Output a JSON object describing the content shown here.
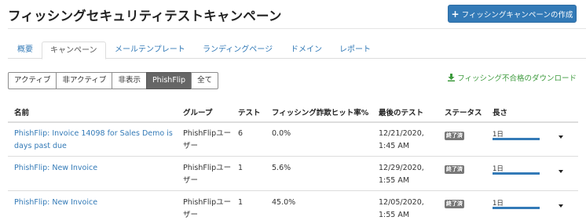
{
  "header": {
    "title": "フィッシングセキュリティテストキャンペーン",
    "create_button": "フィッシングキャンペーンの作成"
  },
  "tabs": [
    {
      "label": "概要",
      "active": false
    },
    {
      "label": "キャンペーン",
      "active": true
    },
    {
      "label": "メールテンプレート",
      "active": false
    },
    {
      "label": "ランディングページ",
      "active": false
    },
    {
      "label": "ドメイン",
      "active": false
    },
    {
      "label": "レポート",
      "active": false
    }
  ],
  "filters": [
    {
      "label": "アクティブ",
      "active": false
    },
    {
      "label": "非アクティブ",
      "active": false
    },
    {
      "label": "非表示",
      "active": false
    },
    {
      "label": "PhishFlip",
      "active": true
    },
    {
      "label": "全て",
      "active": false
    }
  ],
  "download_link": "フィッシング不合格のダウンロード",
  "table": {
    "columns": [
      "名前",
      "グループ",
      "テスト",
      "フィッシング詐欺ヒット率%",
      "最後のテスト",
      "ステータス",
      "長さ"
    ],
    "rows": [
      {
        "name": "PhishFlip: Invoice 14098 for Sales Demo is days past due",
        "group": "PhishFlipユーザー",
        "tests": "6",
        "rate": "0.0%",
        "last_test": "12/21/2020, 1:45 AM",
        "status": "終了済",
        "duration": "1日",
        "duration_fill": 1.0
      },
      {
        "name": "PhishFlip: New Invoice",
        "group": "PhishFlipユーザー",
        "tests": "1",
        "rate": "5.6%",
        "last_test": "12/29/2020, 1:55 AM",
        "status": "終了済",
        "duration": "1日",
        "duration_fill": 1.0
      },
      {
        "name": "PhishFlip: New Invoice",
        "group": "PhishFlipユーザー",
        "tests": "1",
        "rate": "45.0%",
        "last_test": "12/05/2020, 1:55 AM",
        "status": "終了済",
        "duration": "1日",
        "duration_fill": 1.0
      }
    ]
  },
  "colors": {
    "accent": "#337ab7",
    "download": "#3c9a3c",
    "badge": "#777777"
  }
}
